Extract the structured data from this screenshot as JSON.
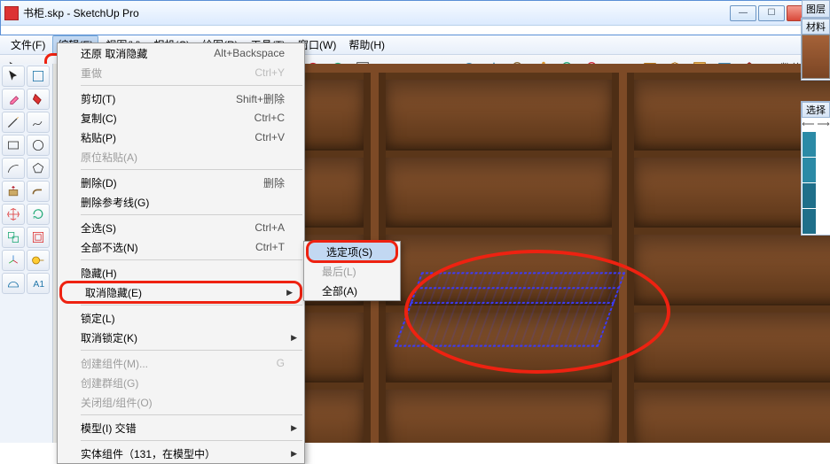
{
  "window": {
    "title": "书柜.skp - SketchUp Pro"
  },
  "menubar": {
    "items": [
      "文件(F)",
      "编辑(E)",
      "视图(V)",
      "相机(C)",
      "绘图(R)",
      "工具(T)",
      "窗口(W)",
      "帮助(H)"
    ],
    "active_index": 1
  },
  "toolbar_label": "数值",
  "edit_menu": {
    "rows": [
      {
        "label": "还原 取消隐藏",
        "shortcut": "Alt+Backspace",
        "enabled": true
      },
      {
        "label": "重做",
        "shortcut": "Ctrl+Y",
        "enabled": false
      },
      {
        "sep": true
      },
      {
        "label": "剪切(T)",
        "shortcut": "Shift+删除",
        "enabled": true
      },
      {
        "label": "复制(C)",
        "shortcut": "Ctrl+C",
        "enabled": true
      },
      {
        "label": "粘贴(P)",
        "shortcut": "Ctrl+V",
        "enabled": true
      },
      {
        "label": "原位粘贴(A)",
        "shortcut": "",
        "enabled": false
      },
      {
        "sep": true
      },
      {
        "label": "删除(D)",
        "shortcut": "删除",
        "enabled": true
      },
      {
        "label": "删除参考线(G)",
        "shortcut": "",
        "enabled": true
      },
      {
        "sep": true
      },
      {
        "label": "全选(S)",
        "shortcut": "Ctrl+A",
        "enabled": true
      },
      {
        "label": "全部不选(N)",
        "shortcut": "Ctrl+T",
        "enabled": true
      },
      {
        "sep": true
      },
      {
        "label": "隐藏(H)",
        "shortcut": "",
        "enabled": true
      },
      {
        "label": "取消隐藏(E)",
        "shortcut": "",
        "enabled": true,
        "sub": true,
        "highlight": true
      },
      {
        "sep": true
      },
      {
        "label": "锁定(L)",
        "shortcut": "",
        "enabled": true
      },
      {
        "label": "取消锁定(K)",
        "shortcut": "",
        "enabled": true,
        "sub": true
      },
      {
        "sep": true
      },
      {
        "label": "创建组件(M)...",
        "shortcut": "G",
        "enabled": false
      },
      {
        "label": "创建群组(G)",
        "shortcut": "",
        "enabled": false
      },
      {
        "label": "关闭组/组件(O)",
        "shortcut": "",
        "enabled": false
      },
      {
        "sep": true
      },
      {
        "label": "模型(I) 交错",
        "shortcut": "",
        "enabled": true,
        "sub": true
      },
      {
        "sep": true
      },
      {
        "label": "实体组件（131，在模型中）",
        "shortcut": "",
        "enabled": true,
        "sub": true
      }
    ]
  },
  "submenu": {
    "rows": [
      {
        "label": "选定项(S)",
        "enabled": true,
        "highlight": true,
        "hover": true
      },
      {
        "label": "最后(L)",
        "enabled": false
      },
      {
        "label": "全部(A)",
        "enabled": true
      }
    ]
  },
  "right_panels": {
    "tab1": "图层",
    "tab2": "材料",
    "tab3": "选择"
  },
  "colors": {
    "wood": "#7d4a26",
    "annot": "#e21"
  }
}
